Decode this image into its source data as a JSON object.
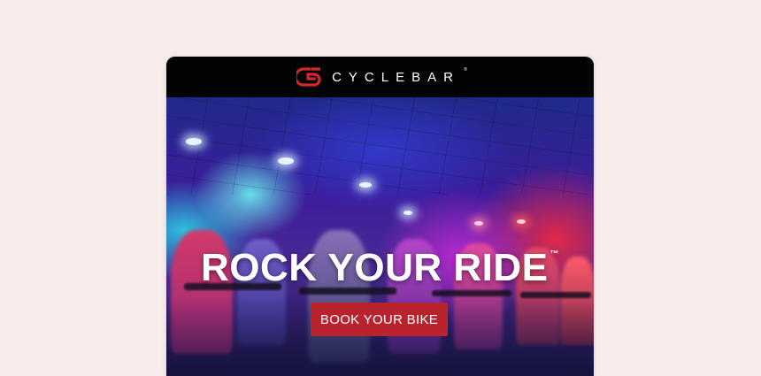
{
  "brand": {
    "name": "CYCLEBAR",
    "registered_mark": "®",
    "logo_icon": "cyclebar-logo-icon",
    "accent_color": "#d4262e"
  },
  "hero": {
    "headline": "ROCK YOUR RIDE",
    "trademark": "™",
    "cta_label": "BOOK YOUR BIKE",
    "cta_color": "#b8232e"
  }
}
